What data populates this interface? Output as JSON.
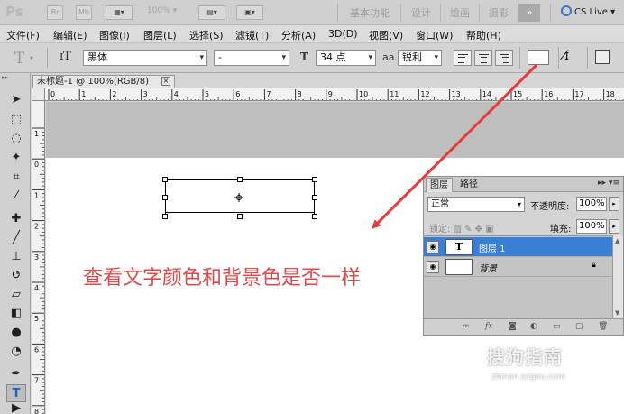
{
  "appbar": {
    "logo": "Ps",
    "br_label": "Br",
    "mb_label": "Mb",
    "zoom": "100%",
    "workspaces": [
      "基本功能",
      "设计",
      "绘画",
      "摄影"
    ],
    "more_label": "»",
    "cs_live": "CS Live"
  },
  "menubar": {
    "items": [
      "文件(F)",
      "编辑(E)",
      "图像(I)",
      "图层(L)",
      "选择(S)",
      "滤镜(T)",
      "分析(A)",
      "3D(D)",
      "视图(V)",
      "窗口(W)",
      "帮助(H)"
    ]
  },
  "options": {
    "tool_glyph": "T",
    "orient_glyph": "ɪT",
    "font_family": "黑体",
    "font_style": "-",
    "size_glyph": "T",
    "font_size": "34 点",
    "aa_glyph": "aa",
    "antialias": "锐利"
  },
  "document": {
    "tab_title": "未标题-1 @ 100%(RGB/8)",
    "close_glyph": "×",
    "ruler_h_labels": [
      "0",
      "1",
      "2",
      "3",
      "4",
      "5",
      "6",
      "7",
      "8",
      "9",
      "10",
      "11",
      "12",
      "13",
      "14",
      "15",
      "16",
      "17",
      "18"
    ],
    "ruler_v_labels": [
      "1",
      "0",
      "1",
      "2",
      "3",
      "4",
      "5",
      "6",
      "7",
      "8"
    ]
  },
  "annotation": {
    "text": "查看文字颜色和背景色是否一样",
    "color": "#e34848"
  },
  "layers_panel": {
    "tabs": [
      "图层",
      "路径"
    ],
    "menu_glyph": "▸▸ ▾≡",
    "blend_mode": "正常",
    "opacity_label": "不透明度:",
    "opacity_value": "100%",
    "lock_label": "锁定:",
    "fill_label": "填充:",
    "fill_value": "100%",
    "layers": [
      {
        "name": "图层 1",
        "thumb": "T",
        "selected": true
      },
      {
        "name": "背景",
        "thumb": "",
        "selected": false
      }
    ],
    "bottom_icons": [
      "link-icon",
      "fx-icon",
      "mask-icon",
      "adjustment-icon",
      "folder-icon",
      "new-layer-icon",
      "trash-icon"
    ],
    "fx_label": "fx"
  },
  "watermark": {
    "text": "搜狗指南",
    "sub": "zhinan.sogou.com"
  },
  "colors": {
    "selection": "#3a7fd6",
    "arrow": "#e83b3b",
    "pasteboard": "#bebebe"
  }
}
